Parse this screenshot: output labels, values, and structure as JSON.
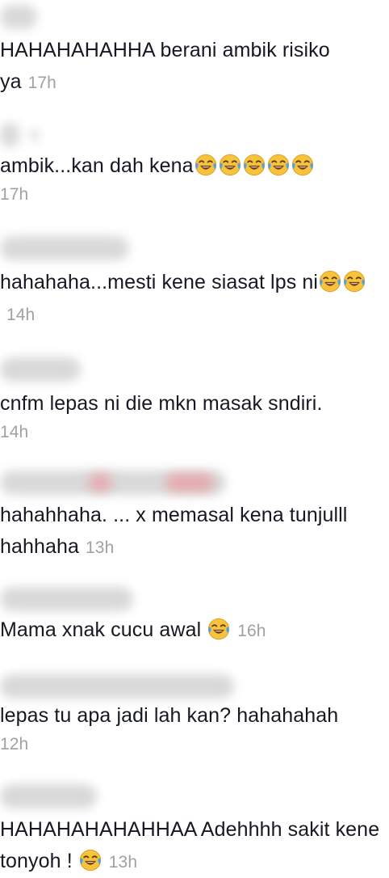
{
  "comments": [
    {
      "text": "HAHAHAHAHHA berani ambik risiko ya",
      "time": "17h"
    },
    {
      "text": "ambik...kan dah kena",
      "emoji_count": 5,
      "time": "17h"
    },
    {
      "text": "hahahaha...mesti kene siasat lps ni",
      "time": "14h"
    },
    {
      "text": "cnfm lepas ni die mkn masak sndiri.",
      "time": "14h"
    },
    {
      "text": "hahahhaha. ... x memasal kena tunjulll hahhaha",
      "time": "13h"
    },
    {
      "text": "Mama xnak cucu awal",
      "time": "16h"
    },
    {
      "text": "lepas tu apa jadi lah kan? hahahahah",
      "time": "12h"
    },
    {
      "text": "HAHAHAHAHAHHAA Adehhhh sakit kene tonyoh !",
      "time": "13h"
    }
  ],
  "icons": {
    "emoji": "face-with-tears-of-joy-icon"
  },
  "colors": {
    "text": "#161823",
    "time": "#a0a0a6",
    "emoji_face": "#f6c33b"
  }
}
